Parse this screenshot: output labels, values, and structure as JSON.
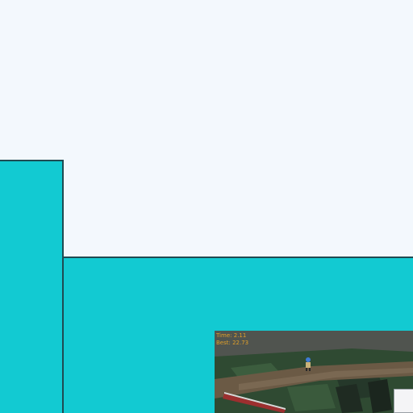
{
  "game": {
    "hud": {
      "time_label": "Time:",
      "time_value": "2.11",
      "best_label": "Best:",
      "best_value": "22.73"
    }
  },
  "colors": {
    "background": "#f3f8fd",
    "panel_fill": "#12cad2",
    "panel_border": "#1f4b52",
    "hud_text": "#e0a02a"
  }
}
